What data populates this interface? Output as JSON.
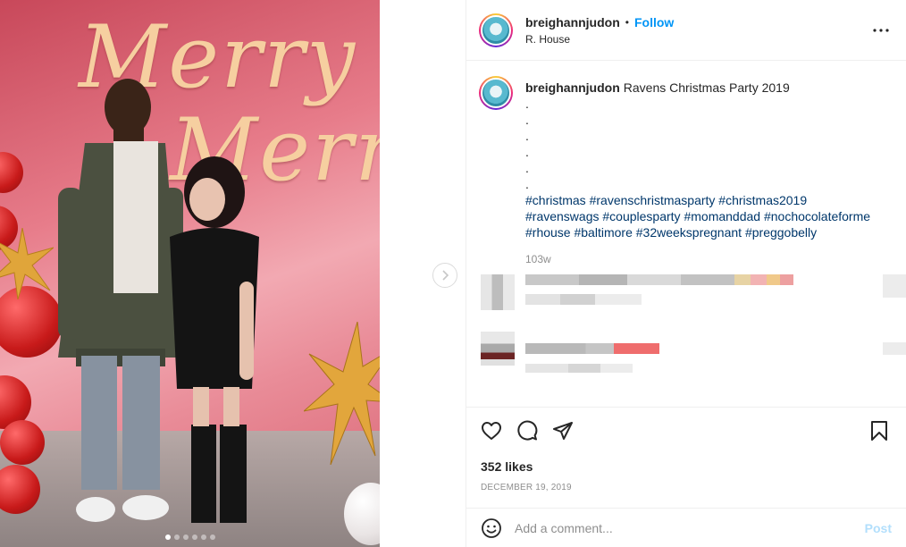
{
  "header": {
    "username": "breighannjudon",
    "separator": "•",
    "follow_label": "Follow",
    "location": "R. House"
  },
  "media": {
    "photo_text": "Merry Merry",
    "carousel_count": 6,
    "carousel_active": 1
  },
  "caption": {
    "username": "breighannjudon",
    "text": "Ravens Christmas Party 2019",
    "dots": [
      ".",
      ".",
      ".",
      ".",
      ".",
      "."
    ],
    "hashtags_line1": [
      "#christmas",
      "#ravenschristmasparty",
      "#christmas2019"
    ],
    "hashtags_line2": [
      "#ravenswags",
      "#couplesparty",
      "#momanddad",
      "#nochocolateforme"
    ],
    "hashtags_line3": [
      "#rhouse",
      "#baltimore",
      "#32weekspregnant",
      "#preggobelly"
    ],
    "age": "103w"
  },
  "actions": {
    "likes": "352 likes",
    "date": "DECEMBER 19, 2019"
  },
  "comment_box": {
    "placeholder": "Add a comment...",
    "post_label": "Post"
  },
  "colors": {
    "link_blue": "#0095f6",
    "hashtag_blue": "#00376b",
    "muted": "#8e8e8e",
    "post_disabled": "#b2dffc"
  }
}
